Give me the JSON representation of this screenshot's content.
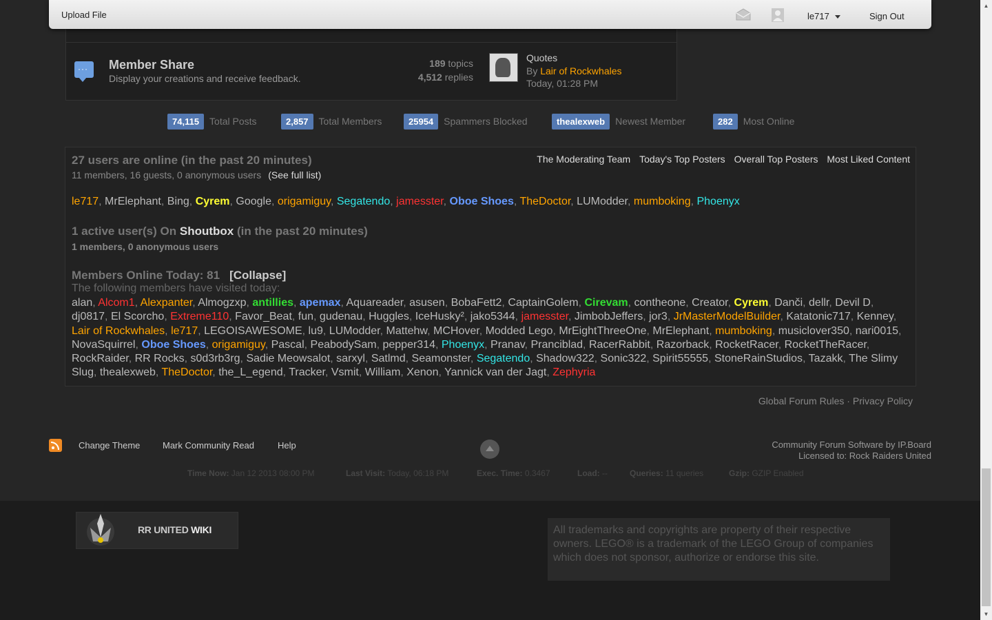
{
  "topbar": {
    "upload": "Upload File",
    "user": "le717",
    "signout": "Sign Out"
  },
  "forum": {
    "name": "Member Share",
    "description": "Display your creations and receive feedback.",
    "topics_num": "189",
    "topics_label": "topics",
    "replies_num": "4,512",
    "replies_label": "replies",
    "last_post_title": "Quotes",
    "last_post_by": "By",
    "last_post_author": "Lair of Rockwhales",
    "last_post_time": "Today, 01:28 PM"
  },
  "stats": [
    {
      "num": "74,115",
      "label": "Total Posts"
    },
    {
      "num": "2,857",
      "label": "Total Members"
    },
    {
      "num": "25954",
      "label": "Spammers Blocked"
    },
    {
      "num": "thealexweb",
      "label": "Newest Member"
    },
    {
      "num": "282",
      "label": "Most Online"
    }
  ],
  "online": {
    "title": "27 users are online (in the past 20 minutes)",
    "subtitle": "11 members, 16 guests, 0 anonymous users",
    "full_list": "(See full list)",
    "links": [
      "The Moderating Team",
      "Today's Top Posters",
      "Overall Top Posters",
      "Most Liked Content"
    ],
    "users": [
      {
        "n": "le717",
        "c": "orange"
      },
      {
        "n": "MrElephant",
        "c": "gray"
      },
      {
        "n": "Bing",
        "c": "gray"
      },
      {
        "n": "Cyrem",
        "c": "yellow"
      },
      {
        "n": "Google",
        "c": "gray"
      },
      {
        "n": "origamiguy",
        "c": "orange"
      },
      {
        "n": "Segatendo",
        "c": "cyan"
      },
      {
        "n": "jamesster",
        "c": "red"
      },
      {
        "n": "Oboe Shoes",
        "c": "blue"
      },
      {
        "n": "TheDoctor",
        "c": "orange"
      },
      {
        "n": "LUModder",
        "c": "gray"
      },
      {
        "n": "mumboking",
        "c": "orange"
      },
      {
        "n": "Phoenyx",
        "c": "cyan"
      }
    ],
    "shoutbox_pre": "1 active user(s) On",
    "shoutbox_name": "Shoutbox",
    "shoutbox_post": "(in the past 20 minutes)",
    "shoutbox_sub": "1 members, 0 anonymous users",
    "today_title": "Members Online Today: 81",
    "collapse": "[Collapse]",
    "today_sub": "The following members have visited today:",
    "today": [
      {
        "n": "alan",
        "c": "gray"
      },
      {
        "n": "Alcom1",
        "c": "red"
      },
      {
        "n": "Alexpanter",
        "c": "orange"
      },
      {
        "n": "Almogzxp",
        "c": "gray"
      },
      {
        "n": "antillies",
        "c": "green"
      },
      {
        "n": "apemax",
        "c": "blue"
      },
      {
        "n": "Aquareader",
        "c": "gray"
      },
      {
        "n": "asusen",
        "c": "gray"
      },
      {
        "n": "BobaFett2",
        "c": "gray"
      },
      {
        "n": "CaptainGolem",
        "c": "gray"
      },
      {
        "n": "Cirevam",
        "c": "green"
      },
      {
        "n": "contheone",
        "c": "gray"
      },
      {
        "n": "Creator",
        "c": "gray"
      },
      {
        "n": "Cyrem",
        "c": "yellow"
      },
      {
        "n": "Danči",
        "c": "gray"
      },
      {
        "n": "dellr",
        "c": "gray"
      },
      {
        "n": "Devil D",
        "c": "gray"
      },
      {
        "n": "dj0817",
        "c": "gray"
      },
      {
        "n": "El Scorcho",
        "c": "gray"
      },
      {
        "n": "Extreme110",
        "c": "red"
      },
      {
        "n": "Favor_Beat",
        "c": "gray"
      },
      {
        "n": "fun",
        "c": "gray"
      },
      {
        "n": "gudenau",
        "c": "gray"
      },
      {
        "n": "Huggles",
        "c": "gray"
      },
      {
        "n": "IceHusky²",
        "c": "gray"
      },
      {
        "n": "jako5344",
        "c": "gray"
      },
      {
        "n": "jamesster",
        "c": "red"
      },
      {
        "n": "JimbobJeffers",
        "c": "gray"
      },
      {
        "n": "jor3",
        "c": "gray"
      },
      {
        "n": "JrMasterModelBuilder",
        "c": "orange"
      },
      {
        "n": "Katatonic717",
        "c": "gray"
      },
      {
        "n": "Kenney",
        "c": "gray"
      },
      {
        "n": "Lair of Rockwhales",
        "c": "orange"
      },
      {
        "n": "le717",
        "c": "orange"
      },
      {
        "n": "LEGOISAWESOME",
        "c": "gray"
      },
      {
        "n": "lu9",
        "c": "gray"
      },
      {
        "n": "LUModder",
        "c": "gray"
      },
      {
        "n": "Mattehw",
        "c": "gray"
      },
      {
        "n": "MCHover",
        "c": "gray"
      },
      {
        "n": "Modded Lego",
        "c": "gray"
      },
      {
        "n": "MrEightThreeOne",
        "c": "gray"
      },
      {
        "n": "MrElephant",
        "c": "gray"
      },
      {
        "n": "mumboking",
        "c": "orange"
      },
      {
        "n": "musiclover350",
        "c": "gray"
      },
      {
        "n": "nari0015",
        "c": "gray"
      },
      {
        "n": "NovaSquirrel",
        "c": "gray"
      },
      {
        "n": "Oboe Shoes",
        "c": "blue"
      },
      {
        "n": "origamiguy",
        "c": "orange"
      },
      {
        "n": "Pascal",
        "c": "gray"
      },
      {
        "n": "PeabodySam",
        "c": "gray"
      },
      {
        "n": "pepper314",
        "c": "gray"
      },
      {
        "n": "Phoenyx",
        "c": "cyan"
      },
      {
        "n": "Pranav",
        "c": "gray"
      },
      {
        "n": "Pranciblad",
        "c": "gray"
      },
      {
        "n": "RacerRabbit",
        "c": "gray"
      },
      {
        "n": "Razorback",
        "c": "gray"
      },
      {
        "n": "RocketRacer",
        "c": "gray"
      },
      {
        "n": "RocketTheRacer",
        "c": "gray"
      },
      {
        "n": "RockRaider",
        "c": "gray"
      },
      {
        "n": "RR Rocks",
        "c": "gray"
      },
      {
        "n": "s0d3rb3rg",
        "c": "gray"
      },
      {
        "n": "Sadie Meowsalot",
        "c": "gray"
      },
      {
        "n": "sarxyl",
        "c": "gray"
      },
      {
        "n": "Satlmd",
        "c": "gray"
      },
      {
        "n": "Seamonster",
        "c": "gray"
      },
      {
        "n": "Segatendo",
        "c": "cyan"
      },
      {
        "n": "Shadow322",
        "c": "gray"
      },
      {
        "n": "Sonic322",
        "c": "gray"
      },
      {
        "n": "Spirit55555",
        "c": "gray"
      },
      {
        "n": "StoneRainStudios",
        "c": "gray"
      },
      {
        "n": "Tazakk",
        "c": "gray"
      },
      {
        "n": "The Slimy Slug",
        "c": "gray"
      },
      {
        "n": "thealexweb",
        "c": "gray"
      },
      {
        "n": "TheDoctor",
        "c": "orange"
      },
      {
        "n": "the_L_egend",
        "c": "gray"
      },
      {
        "n": "Tracker",
        "c": "gray"
      },
      {
        "n": "Vsmit",
        "c": "gray"
      },
      {
        "n": "William",
        "c": "gray"
      },
      {
        "n": "Xenon",
        "c": "gray"
      },
      {
        "n": "Yannick van der Jagt",
        "c": "gray"
      },
      {
        "n": "Zephyria",
        "c": "red"
      }
    ]
  },
  "rules": {
    "global": "Global Forum Rules",
    "sep": "·",
    "privacy": "Privacy Policy"
  },
  "footer": {
    "change_theme": "Change Theme",
    "mark_read": "Mark Community Read",
    "help": "Help",
    "credits_1": "Community Forum Software by IP.Board",
    "credits_2": "Licensed to: Rock Raiders United",
    "time_now_label": "Time Now:",
    "time_now": "Jan 12 2013 08:00 PM",
    "last_visit_label": "Last Visit:",
    "last_visit": "Today, 06:18 PM",
    "exec_label": "Exec. Time:",
    "exec": "0.3467",
    "load_label": "Load:",
    "load": "--",
    "queries_label": "Queries:",
    "queries": "11 queries",
    "gzip_label": "Gzip:",
    "gzip": "GZIP Enabled"
  },
  "wiki": {
    "prefix": "RR UNITED",
    "suffix": "WIKI"
  },
  "disclaimer": "All trademarks and copyrights are property of their respective owners. LEGO® is a trademark of the LEGO Group of companies which does not sponsor, authorize or endorse this site."
}
